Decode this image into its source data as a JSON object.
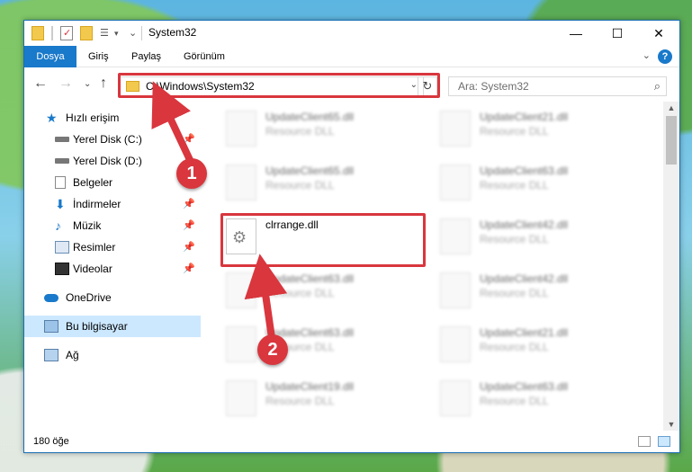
{
  "window": {
    "title": "System32",
    "minimize": "—",
    "maximize": "☐",
    "close": "✕"
  },
  "ribbon": {
    "tabs": [
      {
        "label": "Dosya"
      },
      {
        "label": "Giriş"
      },
      {
        "label": "Paylaş"
      },
      {
        "label": "Görünüm"
      }
    ],
    "help": "?"
  },
  "nav": {
    "address": "C:\\Windows\\System32",
    "search_placeholder": "Ara: System32"
  },
  "sidebar": {
    "items": [
      {
        "label": "Hızlı erişim",
        "icon": "star-icon"
      },
      {
        "label": "Yerel Disk (C:)",
        "icon": "drive-icon",
        "pinned": true
      },
      {
        "label": "Yerel Disk (D:)",
        "icon": "drive-icon"
      },
      {
        "label": "Belgeler",
        "icon": "documents-icon"
      },
      {
        "label": "İndirmeler",
        "icon": "download-icon",
        "pinned": true
      },
      {
        "label": "Müzik",
        "icon": "music-icon",
        "pinned": true
      },
      {
        "label": "Resimler",
        "icon": "pictures-icon",
        "pinned": true
      },
      {
        "label": "Videolar",
        "icon": "video-icon",
        "pinned": true
      },
      {
        "label": "OneDrive",
        "icon": "cloud-icon"
      },
      {
        "label": "Bu bilgisayar",
        "icon": "computer-icon",
        "selected": true
      },
      {
        "label": "Ağ",
        "icon": "network-icon"
      }
    ]
  },
  "files": {
    "left": [
      {
        "name": "UpdateClient65.dll",
        "type": "Resource DLL"
      },
      {
        "name": "UpdateClient65.dll",
        "type": "Resource DLL"
      },
      {
        "name": "clrrange.dll",
        "type": ""
      },
      {
        "name": "UpdateClient63.dll",
        "type": "Resource DLL"
      },
      {
        "name": "UpdateClient63.dll",
        "type": "Resource DLL"
      },
      {
        "name": "UpdateClient19.dll",
        "type": "Resource DLL"
      }
    ],
    "right": [
      {
        "name": "UpdateClient21.dll",
        "type": "Resource DLL"
      },
      {
        "name": "UpdateClient63.dll",
        "type": "Resource DLL"
      },
      {
        "name": "UpdateClient42.dll",
        "type": "Resource DLL"
      },
      {
        "name": "UpdateClient42.dll",
        "type": "Resource DLL"
      },
      {
        "name": "UpdateClient21.dll",
        "type": "Resource DLL"
      },
      {
        "name": "UpdateClient63.dll",
        "type": "Resource DLL"
      }
    ]
  },
  "status": {
    "count": "180 öğe"
  },
  "annotations": {
    "step1": "1",
    "step2": "2",
    "highlight_color": "#d9363e"
  }
}
